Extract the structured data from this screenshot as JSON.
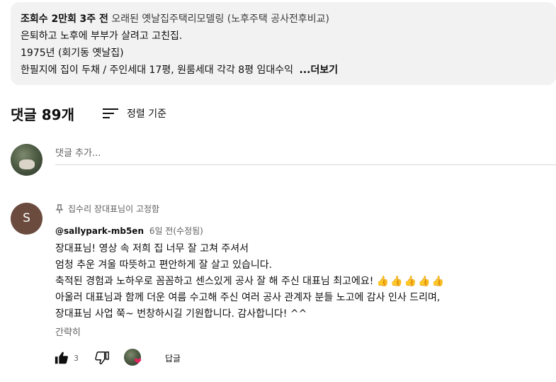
{
  "description": {
    "views": "조회수 2만회",
    "age": "3주 전",
    "tags": "오래된 옛날집주택리모델링 (노후주택 공사전후비교)",
    "lines": [
      "은퇴하고 노후에 부부가 살려고 고친집.",
      "1975년 (회기동 옛날집)",
      "한필지에 집이 두채 / 주인세대 17평, 원룸세대 각각 8평 임대수익"
    ],
    "more_label": "...더보기"
  },
  "comments_header": {
    "count_label": "댓글 89개",
    "sort_label": "정렬 기준",
    "sort_icon": "sort-icon"
  },
  "add_comment": {
    "placeholder": "댓글 추가..."
  },
  "pinned_comment": {
    "avatar_letter": "S",
    "pinned_label": "집수리 장대표님이 고정함",
    "author": "@sallypark-mb5en",
    "time": "6일 전(수정됨)",
    "lines": [
      "장대표님! 영상 속 저희 집 너무 잘 고쳐 주셔서",
      "엄청 추운 겨울 따뜻하고 편안하게 잘 살고 있습니다.",
      "축적된 경험과 노하우로 꼼꼼하고 센스있게 공사 잘 해 주신 대표님 최고에요!",
      "아울러 대표님과 함께 더운 여름 수고해 주신 여러 공사 관계자 분들 노고에 감사 인사 드리며,",
      "장대표님 사업 쭉~ 번창하시길 기원합니다. 감사합니다! ^^"
    ],
    "thumbs": "👍👍👍👍👍",
    "collapse_label": "간략히",
    "like_count": "3",
    "reply_label": "답글",
    "heart_icon": "heart-icon"
  }
}
